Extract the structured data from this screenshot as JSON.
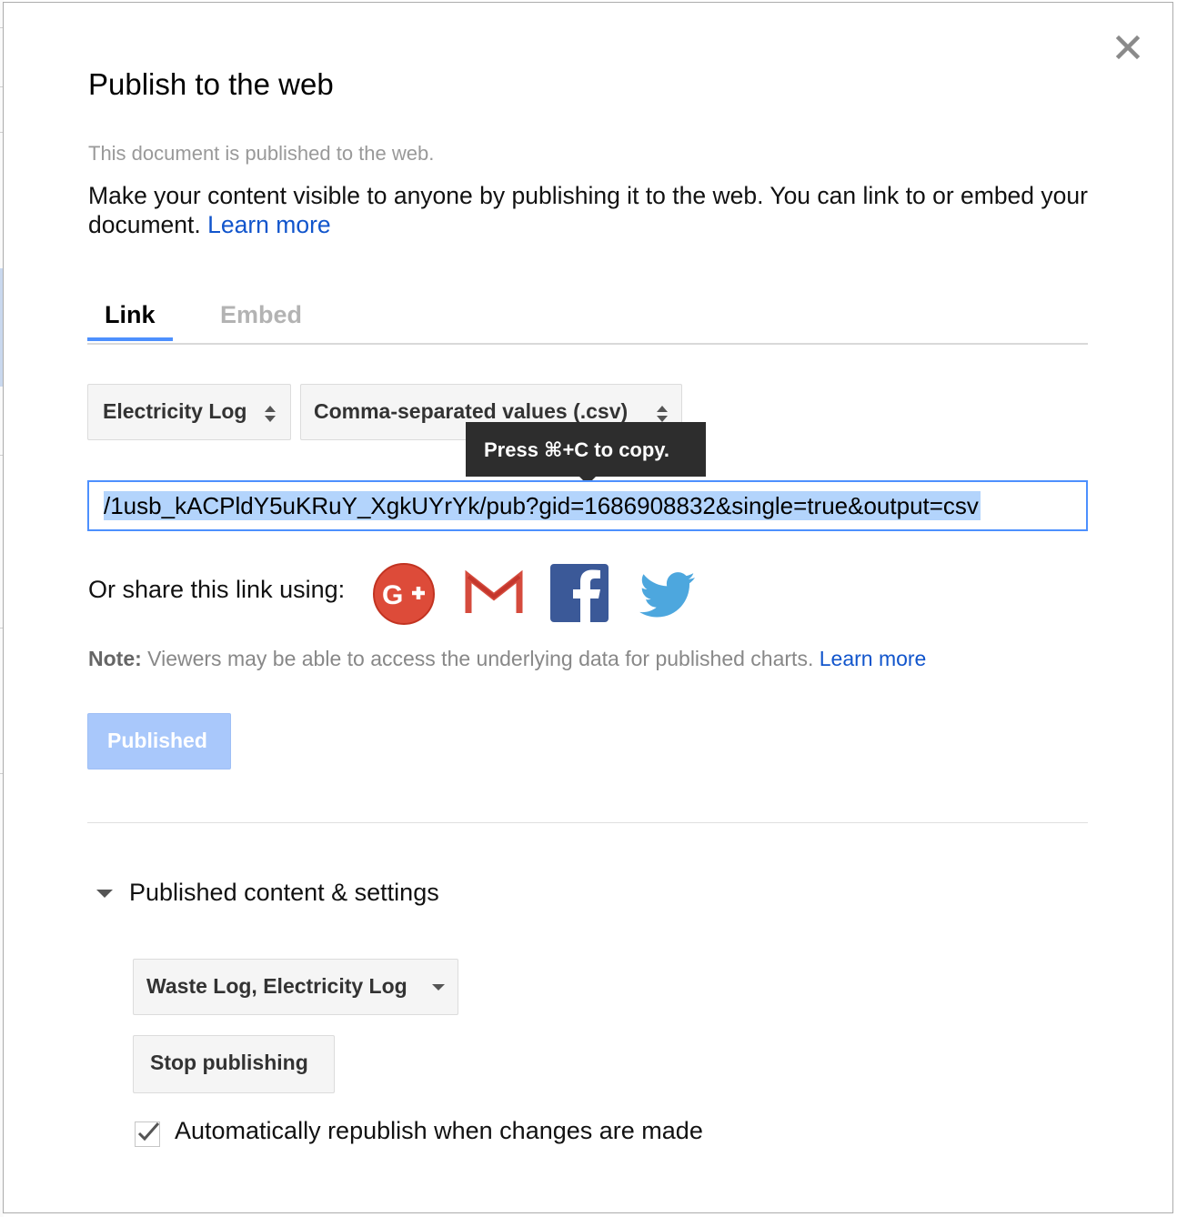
{
  "dialog": {
    "title": "Publish to the web",
    "status": "This document is published to the web.",
    "description": "Make your content visible to anyone by publishing it to the web. You can link to or embed your document.",
    "learn_more": "Learn more",
    "close_icon": "close-icon"
  },
  "tabs": [
    {
      "label": "Link",
      "active": true
    },
    {
      "label": "Embed",
      "active": false
    }
  ],
  "selectors": {
    "sheet": "Electricity Log",
    "format": "Comma-separated values (.csv)"
  },
  "tooltip": "Press ⌘+C to copy.",
  "url": {
    "value": "/1usb_kACPldY5uKRuY_XgkUYrYk/pub?gid=1686908832&single=true&output=csv"
  },
  "share": {
    "label": "Or share this link using:",
    "services": [
      "google-plus-icon",
      "gmail-icon",
      "facebook-icon",
      "twitter-icon"
    ]
  },
  "note": {
    "label": "Note:",
    "text": "Viewers may be able to access the underlying data for published charts.",
    "learn_more": "Learn more"
  },
  "published_button": "Published",
  "settings": {
    "heading": "Published content & settings",
    "sheets_value": "Waste Log, Electricity Log",
    "stop_button": "Stop publishing",
    "auto_republish_label": "Automatically republish when changes are made",
    "auto_republish_checked": true
  },
  "colors": {
    "accent": "#4d90fe",
    "link": "#1155cc",
    "published_bg": "#a9c8fb",
    "selection": "#b3d4fc"
  }
}
